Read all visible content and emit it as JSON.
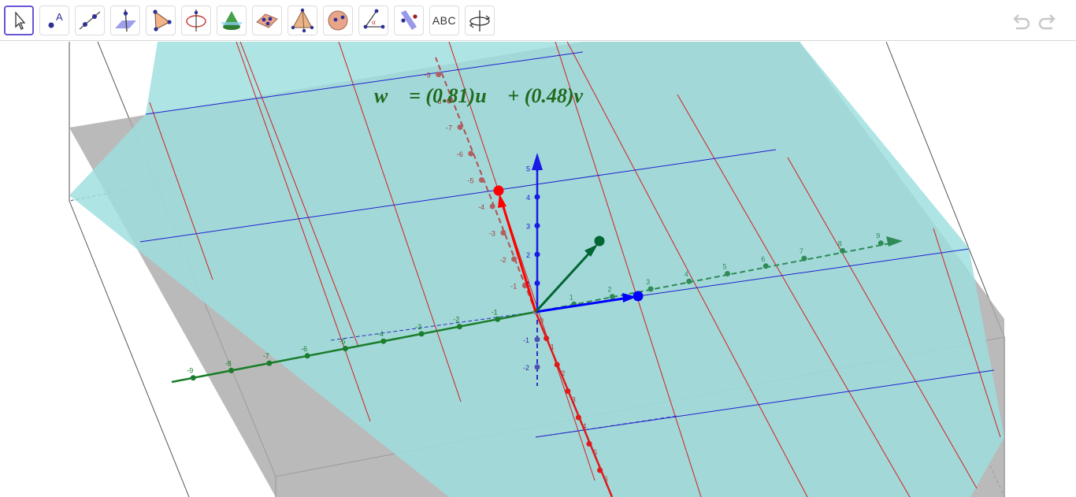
{
  "toolbar": {
    "tools": [
      {
        "name": "move-tool",
        "icon": "cursor-arrow-icon",
        "active": true
      },
      {
        "name": "point-tool",
        "icon": "point-with-label-icon",
        "label": "A"
      },
      {
        "name": "line-tool",
        "icon": "line-through-two-points-icon"
      },
      {
        "name": "perpendicular-line-tool",
        "icon": "line-perpendicular-to-plane-icon"
      },
      {
        "name": "polygon-tool",
        "icon": "triangle-polygon-icon"
      },
      {
        "name": "circle-around-line-tool",
        "icon": "circle-with-axis-icon"
      },
      {
        "name": "intersect-surfaces-tool",
        "icon": "cone-intersection-icon"
      },
      {
        "name": "plane-through-points-tool",
        "icon": "plane-through-three-points-icon"
      },
      {
        "name": "pyramid-tool",
        "icon": "pyramid-icon"
      },
      {
        "name": "sphere-tool",
        "icon": "sphere-center-point-icon"
      },
      {
        "name": "angle-tool",
        "icon": "angle-icon",
        "label": "α"
      },
      {
        "name": "reflect-tool",
        "icon": "reflect-about-plane-icon"
      },
      {
        "name": "text-tool",
        "icon": "text-icon",
        "label": "ABC"
      },
      {
        "name": "rotate-view-tool",
        "icon": "rotate-3d-view-icon"
      }
    ],
    "undo_icon": "undo-icon",
    "redo_icon": "redo-icon"
  },
  "view": {
    "formula": "w⃗ = (0.81)u⃗ + (0.48)v⃗",
    "colors": {
      "cyan_plane": "#9fdfdf",
      "gray_plane": "#b4b4b4",
      "x_axis": "#e0191a",
      "y_axis": "#1a7d2a",
      "z_axis": "#1a1ae6",
      "vector_u": "#ff0000",
      "vector_v": "#0000ff",
      "vector_w": "#006633",
      "formula": "#1f6b1f"
    },
    "x_axis_labels": {
      "negative": [
        "-1",
        "-2",
        "-3",
        "-4",
        "-5",
        "-6",
        "-7",
        "-8",
        "-9"
      ],
      "positive": [
        "0",
        "1",
        "2",
        "3",
        "4",
        "5",
        "6"
      ]
    },
    "y_axis_labels": {
      "negative": [
        "-1",
        "-2",
        "-3",
        "-4",
        "-5",
        "-6",
        "-7",
        "-8",
        "-9"
      ],
      "positive": [
        "1",
        "2",
        "3",
        "4",
        "5",
        "6",
        "7",
        "8",
        "9"
      ]
    },
    "z_axis_labels": {
      "positive": [
        "1",
        "2",
        "3",
        "4",
        "5"
      ],
      "negative": [
        "-1",
        "-2"
      ]
    }
  }
}
